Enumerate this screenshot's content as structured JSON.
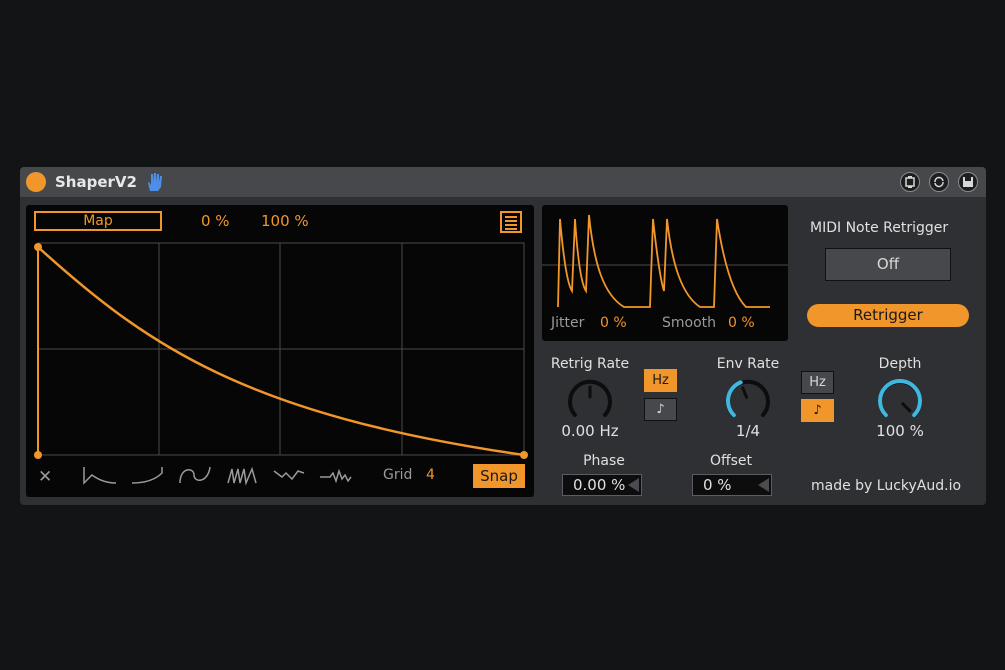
{
  "device": {
    "title": "ShaperV2",
    "icons": {
      "power": "power-icon",
      "hand": "hand-icon",
      "buttons": [
        "settings-icon",
        "sync-icon",
        "save-icon"
      ]
    }
  },
  "editor": {
    "map_label": "Map",
    "min_pct": "0 %",
    "max_pct": "100 %",
    "grid_label": "Grid",
    "grid_value": "4",
    "snap_label": "Snap",
    "clear_icon": "✕",
    "shape_icons": [
      "ramp-down-icon",
      "ramp-up-icon",
      "sine-icon",
      "saw-icon",
      "random-icon",
      "noise-icon"
    ]
  },
  "preview": {
    "jitter_label": "Jitter",
    "jitter_value": "0 %",
    "smooth_label": "Smooth",
    "smooth_value": "0 %"
  },
  "midi": {
    "label": "MIDI Note Retrigger",
    "toggle_value": "Off",
    "retrigger_label": "Retrigger"
  },
  "retrig_rate": {
    "label": "Retrig Rate",
    "value": "0.00 Hz",
    "level": 0.5,
    "hz_label": "Hz",
    "note_label": "♪"
  },
  "env_rate": {
    "label": "Env Rate",
    "value": "1/4",
    "level": 0.42,
    "hz_label": "Hz",
    "note_label": "♪"
  },
  "depth": {
    "label": "Depth",
    "value": "100 %",
    "level": 1.0
  },
  "phase": {
    "label": "Phase",
    "value": "0.00 %"
  },
  "offset": {
    "label": "Offset",
    "value": "0 %"
  },
  "credit": "made by LuckyAud.io",
  "colors": {
    "accent": "#f0962b",
    "knob_blue": "#3fb8e0",
    "panel": "#2f3033",
    "background": "#131416"
  }
}
